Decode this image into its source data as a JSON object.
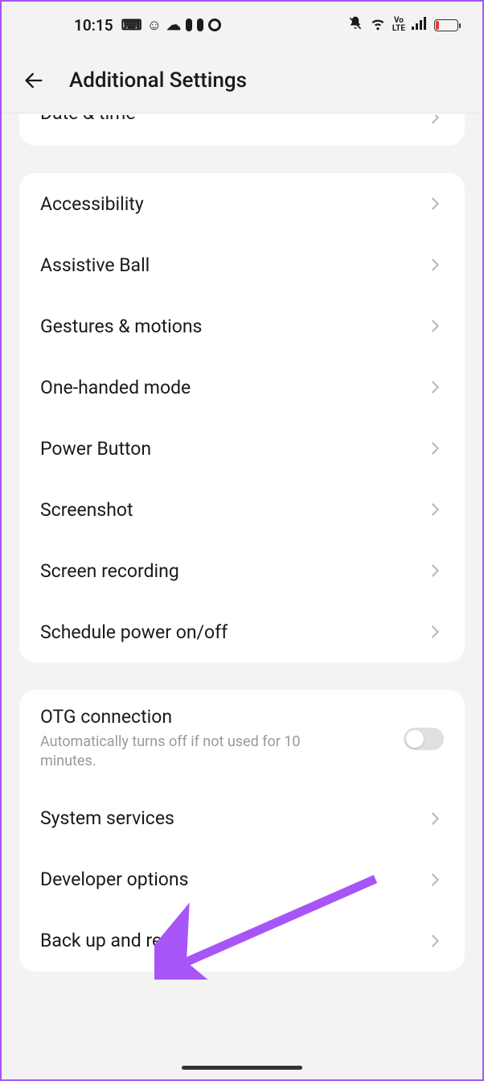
{
  "statusbar": {
    "time": "10:15",
    "left_icons": [
      "keyboard-icon",
      "antenna-icon",
      "cloud-icon",
      "pill-icon",
      "circle-icon"
    ],
    "right_icons": [
      "mute-icon",
      "wifi-icon",
      "volte-icon",
      "signal-icon",
      "battery-low-icon"
    ]
  },
  "header": {
    "title": "Additional Settings"
  },
  "groups": [
    {
      "cut_top": true,
      "items": [
        {
          "label": "Date & time",
          "partial": true,
          "chevron": true
        }
      ]
    },
    {
      "items": [
        {
          "label": "Accessibility",
          "chevron": true
        },
        {
          "label": "Assistive Ball",
          "chevron": true
        },
        {
          "label": "Gestures & motions",
          "chevron": true
        },
        {
          "label": "One-handed mode",
          "chevron": true
        },
        {
          "label": "Power Button",
          "chevron": true
        },
        {
          "label": "Screenshot",
          "chevron": true
        },
        {
          "label": "Screen recording",
          "chevron": true
        },
        {
          "label": "Schedule power on/off",
          "chevron": true
        }
      ]
    },
    {
      "items": [
        {
          "label": "OTG connection",
          "sub": "Automatically turns off if not used for 10 minutes.",
          "toggle": true,
          "toggle_on": false
        },
        {
          "label": "System services",
          "chevron": true
        },
        {
          "label": "Developer options",
          "chevron": true
        },
        {
          "label": "Back up and reset",
          "chevron": true
        }
      ]
    }
  ],
  "annotation": {
    "arrow_color": "#a855f7",
    "target": "Back up and reset"
  }
}
